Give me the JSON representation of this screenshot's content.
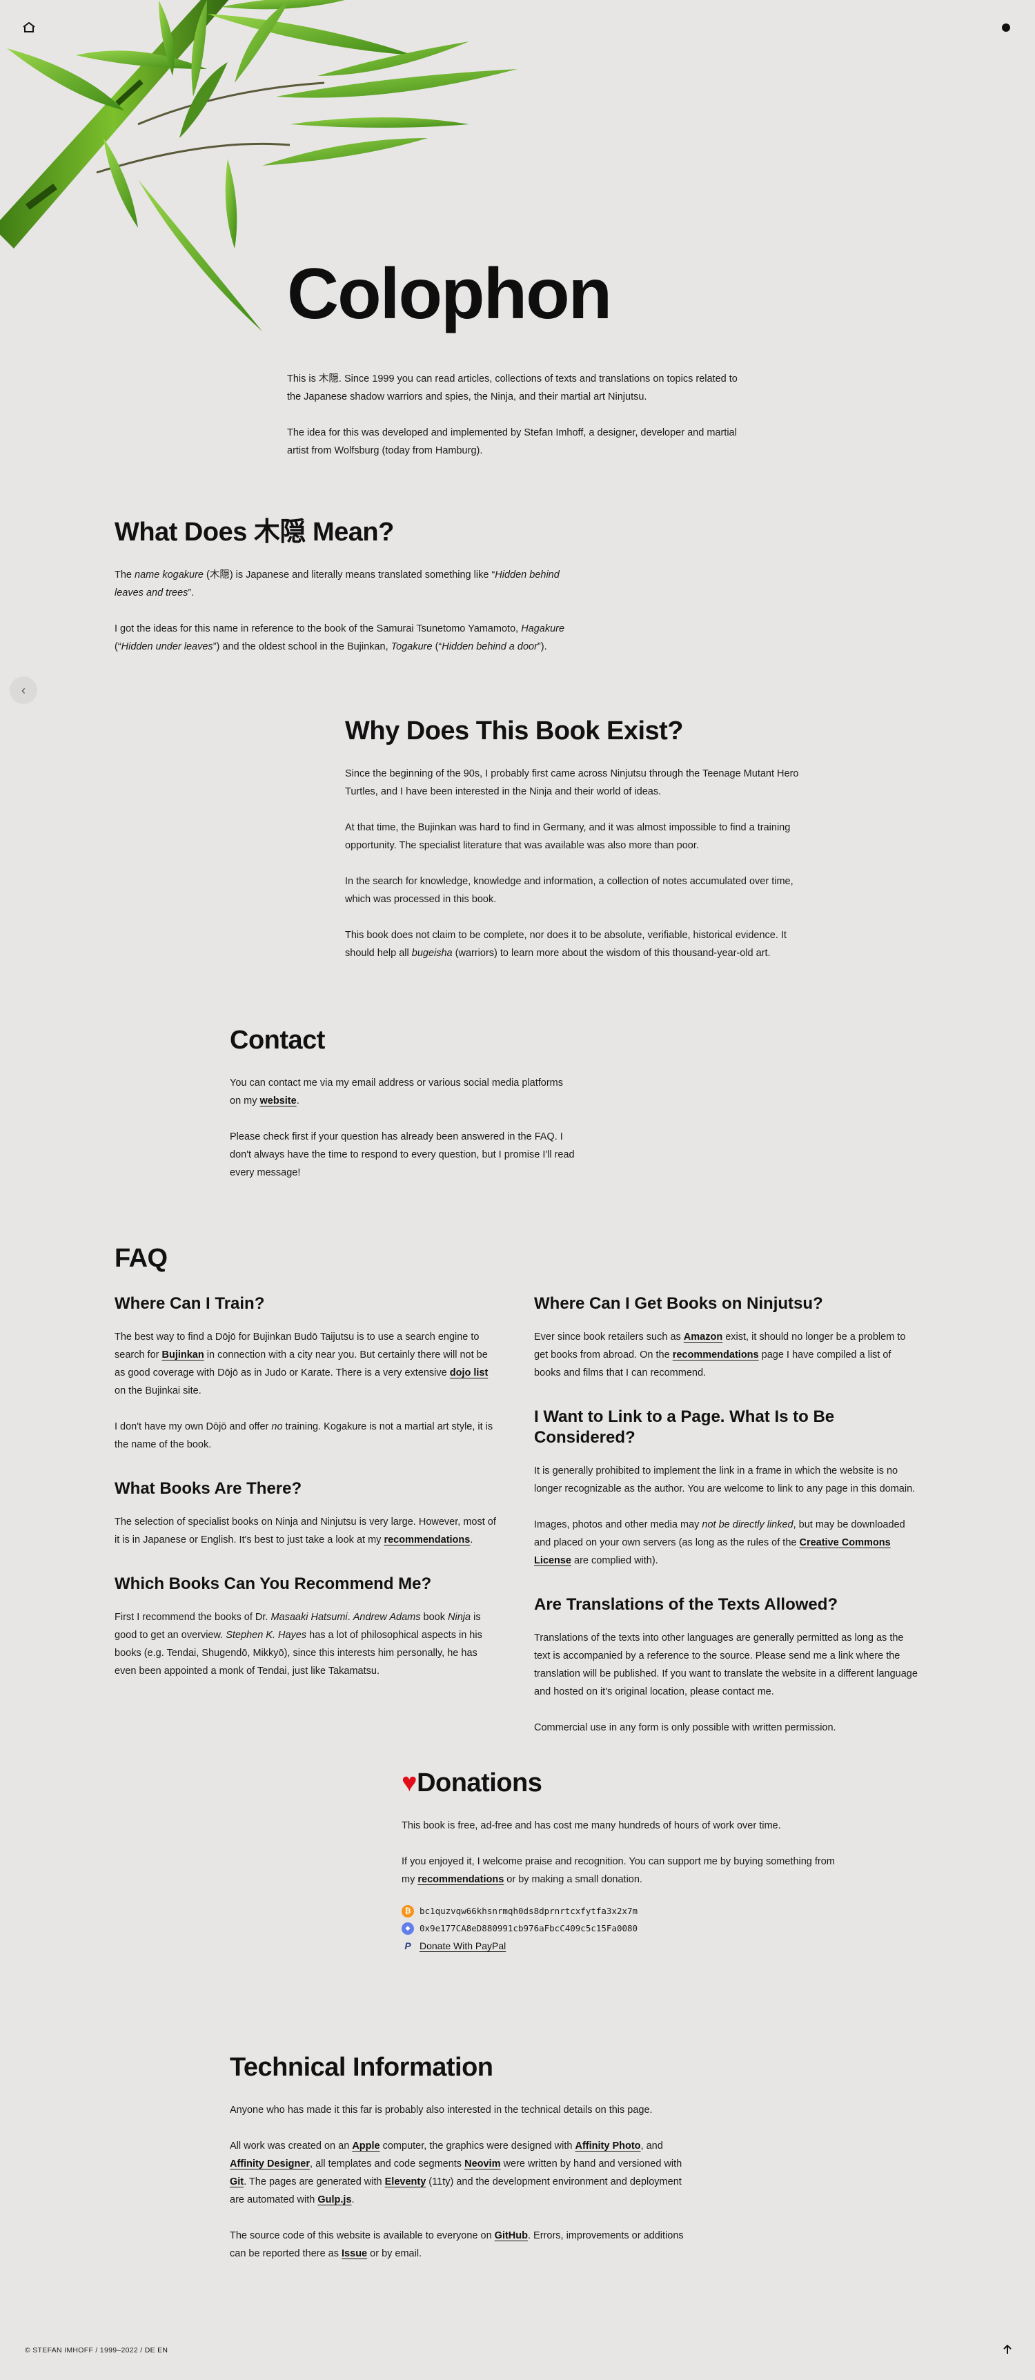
{
  "colors": {
    "background": "#e8e6e5",
    "text": "#141414",
    "heart": "#e10d1a",
    "bitcoin": "#f7931a",
    "ethereum": "#627eea",
    "paypal": "#253b80"
  },
  "nav": {
    "home_icon": "home-icon",
    "menu_icon": "dot-icon",
    "back_icon": "chevron-left-icon",
    "top_icon": "arrow-up-icon"
  },
  "hero": {
    "title": "Colophon"
  },
  "intro": {
    "p1_a": "This is ",
    "p1_kanji": "木隠",
    "p1_b": ". Since 1999 you can read articles, collections of texts and translations on topics related to the Japanese shadow warriors and spies, the Ninja, and their martial art Ninjutsu.",
    "p2": "The idea for this was developed and implemented by Stefan Imhoff, a designer, developer and martial artist from Wolfsburg (today from Hamburg)."
  },
  "meaning": {
    "title": "What Does 木隠 Mean?",
    "p1_a": "The ",
    "p1_name": "name kogakure",
    "p1_b": " (木隠) is Japanese and literally means translated something like “",
    "p1_quote": "Hidden behind leaves and trees",
    "p1_c": "”.",
    "p2_a": "I got the ideas for this name in reference to the book of the Samurai Tsunetomo Yamamoto, ",
    "p2_hagakure": "Hagakure",
    "p2_b": " (“",
    "p2_q1": "Hidden under leaves",
    "p2_c": "”) and the oldest school in the Bujinkan, ",
    "p2_togakure": "Togakure",
    "p2_d": " (“",
    "p2_q2": "Hidden behind a door",
    "p2_e": "”)."
  },
  "why": {
    "title": "Why Does This Book Exist?",
    "p1": "Since the beginning of the 90s, I probably first came across Ninjutsu through the Teenage Mutant Hero Turtles, and I have been interested in the Ninja and their world of ideas.",
    "p2": "At that time, the Bujinkan was hard to find in Germany, and it was almost impossible to find a training opportunity. The specialist literature that was available was also more than poor.",
    "p3": "In the search for knowledge, knowledge and information, a collection of notes accumulated over time, which was processed in this book.",
    "p4_a": "This book does not claim to be complete, nor does it to be absolute, verifiable, historical evidence. It should help all ",
    "p4_bugeisha": "bugeisha",
    "p4_b": " (warriors) to learn more about the wisdom of this thousand-year-old art."
  },
  "contact": {
    "title": "Contact",
    "p1_a": "You can contact me via my email address or various social media platforms on my ",
    "p1_link": "website",
    "p1_b": ".",
    "p2": "Please check first if your question has already been answered in the FAQ. I don't always have the time to respond to every question, but I promise I'll read every message!"
  },
  "faq": {
    "title": "FAQ",
    "train": {
      "q": "Where Can I Train?",
      "p1_a": "The best way to find a Dōjō for Bujinkan Budō Taijutsu is to use a search engine to search for ",
      "p1_bujinkan": "Bujinkan",
      "p1_b": " in connection with a city near you. But certainly there will not be as good coverage with Dōjō as in Judo or Karate. There is a very extensive ",
      "p1_dojo": "dojo list",
      "p1_c": " on the Bujinkai site.",
      "p2_a": "I don't have my own Dōjō and offer ",
      "p2_no": "no",
      "p2_b": " training. Kogakure is not a martial art style, it is the name of the book."
    },
    "books": {
      "q": "What Books Are There?",
      "p1_a": "The selection of specialist books on Ninja and Ninjutsu is very large. However, most of it is in Japanese or English. It's best to just take a look at my ",
      "p1_link": "recommendations",
      "p1_b": "."
    },
    "recommend": {
      "q": "Which Books Can You Recommend Me?",
      "p1_a": "First I recommend the books of Dr. ",
      "p1_hatsumi": "Masaaki Hatsumi",
      "p1_b": ". ",
      "p1_adams": "Andrew Adams",
      "p1_c": " book ",
      "p1_ninja": "Ninja",
      "p1_d": " is good to get an overview. ",
      "p1_hayes": "Stephen K. Hayes",
      "p1_e": " has a lot of philosophical aspects in his books (e.g. Tendai, Shugendō, Mikkyō), since this interests him personally, he has even been appointed a monk of Tendai, just like Takamatsu."
    },
    "getbooks": {
      "q": "Where Can I Get Books on Ninjutsu?",
      "p1_a": "Ever since book retailers such as ",
      "p1_amazon": "Amazon",
      "p1_b": " exist, it should no longer be a problem to get books from abroad. On the ",
      "p1_rec": "recommendations",
      "p1_c": " page I have compiled a list of books and films that I can recommend."
    },
    "link": {
      "q": "I Want to Link to a Page. What Is to Be Considered?",
      "p1": "It is generally prohibited to implement the link in a frame in which the website is no longer recognizable as the author. You are welcome to link to any page in this domain.",
      "p2_a": "Images, photos and other media may ",
      "p2_not": "not be directly linked",
      "p2_b": ", but may be downloaded and placed on your own servers (as long as the rules of the ",
      "p2_cc": "Creative Commons License",
      "p2_c": " are complied with)."
    },
    "translate": {
      "q": "Are Translations of the Texts Allowed?",
      "p1": "Translations of the texts into other languages are generally permitted as long as the text is accompanied by a reference to the source. Please send me a link where the translation will be published. If you want to translate the website in a different language and hosted on it's original location, please contact me.",
      "p2": "Commercial use in any form is only possible with written permission."
    }
  },
  "donations": {
    "heart": "♥",
    "title": "Donations",
    "p1": "This book is free, ad-free and has cost me many hundreds of hours of work over time.",
    "p2_a": "If you enjoyed it, I welcome praise and recognition. You can support me by buying something from my ",
    "p2_link": "recommendations",
    "p2_b": " or by making a small donation.",
    "btc_symbol": "₿",
    "btc": "bc1quzvqw66khsnrmqh0ds8dprnrtcxfytfa3x2x7m",
    "eth_symbol": "◆",
    "eth": "0x9e177CA8eD880991cb976aFbcC409c5c15Fa0080",
    "paypal_symbol": "P",
    "paypal": "Donate With PayPal"
  },
  "tech": {
    "title": "Technical Information",
    "p1": "Anyone who has made it this far is probably also interested in the technical details on this page.",
    "p2_a": "All work was created on an ",
    "apple": "Apple",
    "p2_b": " computer, the graphics were designed with ",
    "photo": "Affinity Photo",
    "p2_c": ", and ",
    "designer": "Affinity Designer",
    "p2_d": ", all templates and code segments ",
    "neovim": "Neovim",
    "p2_e": " were written by hand and versioned with ",
    "git": "Git",
    "p2_f": ". The pages are generated with ",
    "eleventy": "Eleventy",
    "p2_g": " (11ty) and the development environment and deployment are automated with ",
    "gulp": "Gulp.js",
    "p2_h": ".",
    "p3_a": "The source code of this website is available to everyone on ",
    "github": "GitHub",
    "p3_b": ". Errors, improvements or additions can be reported there as ",
    "issue": "Issue",
    "p3_c": " or by email."
  },
  "footer": {
    "copyright": "© STEFAN IMHOFF / 1999–2022 /",
    "lang_de": "DE",
    "lang_en": "EN"
  }
}
